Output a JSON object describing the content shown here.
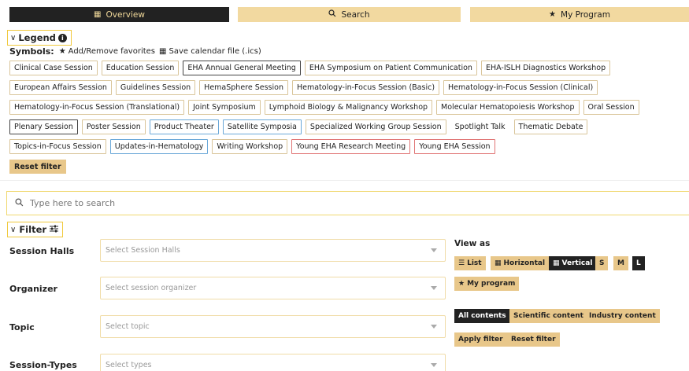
{
  "nav": {
    "overview": "Overview",
    "search": "Search",
    "my_program": "My Program"
  },
  "legend": {
    "title": "Legend",
    "symbols_label": "Symbols:",
    "add_remove": "Add/Remove favorites",
    "save_calendar": "Save calendar file (.ics)",
    "tags": [
      "Clinical Case Session",
      "Education Session",
      "EHA Annual General Meeting",
      "EHA Symposium on Patient Communication",
      "EHA-ISLH Diagnostics Workshop",
      "European Affairs Session",
      "Guidelines Session",
      "HemaSphere Session",
      "Hematology-in-Focus Session (Basic)",
      "Hematology-in-Focus Session (Clinical)",
      "Hematology-in-Focus Session (Translational)",
      "Joint Symposium",
      "Lymphoid Biology & Malignancy Workshop",
      "Molecular Hematopoiesis Workshop",
      "Oral Session",
      "Plenary Session",
      "Poster Session",
      "Product Theater",
      "Satellite Symposia",
      "Specialized Working Group Session",
      "Spotlight Talk",
      "Thematic Debate",
      "Topics-in-Focus Session",
      "Updates-in-Hematology",
      "Writing Workshop",
      "Young EHA Research Meeting",
      "Young EHA Session"
    ],
    "reset_filter": "Reset filter"
  },
  "search": {
    "placeholder": "Type here to search"
  },
  "filter": {
    "title": "Filter",
    "session_halls_label": "Session Halls",
    "session_halls_placeholder": "Select Session Halls",
    "organizer_label": "Organizer",
    "organizer_placeholder": "Select session organizer",
    "topic_label": "Topic",
    "topic_placeholder": "Select topic",
    "session_types_label": "Session-Types",
    "session_types_placeholder": "Select types"
  },
  "view": {
    "label": "View as",
    "list": "List",
    "horizontal": "Horizontal",
    "vertical": "Vertical",
    "s": "S",
    "m": "M",
    "l": "L",
    "my_program": "My program",
    "all_contents": "All contents",
    "scientific": "Scientific content",
    "industry": "Industry content",
    "apply_filter": "Apply filter",
    "reset_filter": "Reset filter"
  },
  "colors": {
    "accent": "#e8c78a",
    "dark": "#222222",
    "highlight_border": "#f0c93c"
  }
}
